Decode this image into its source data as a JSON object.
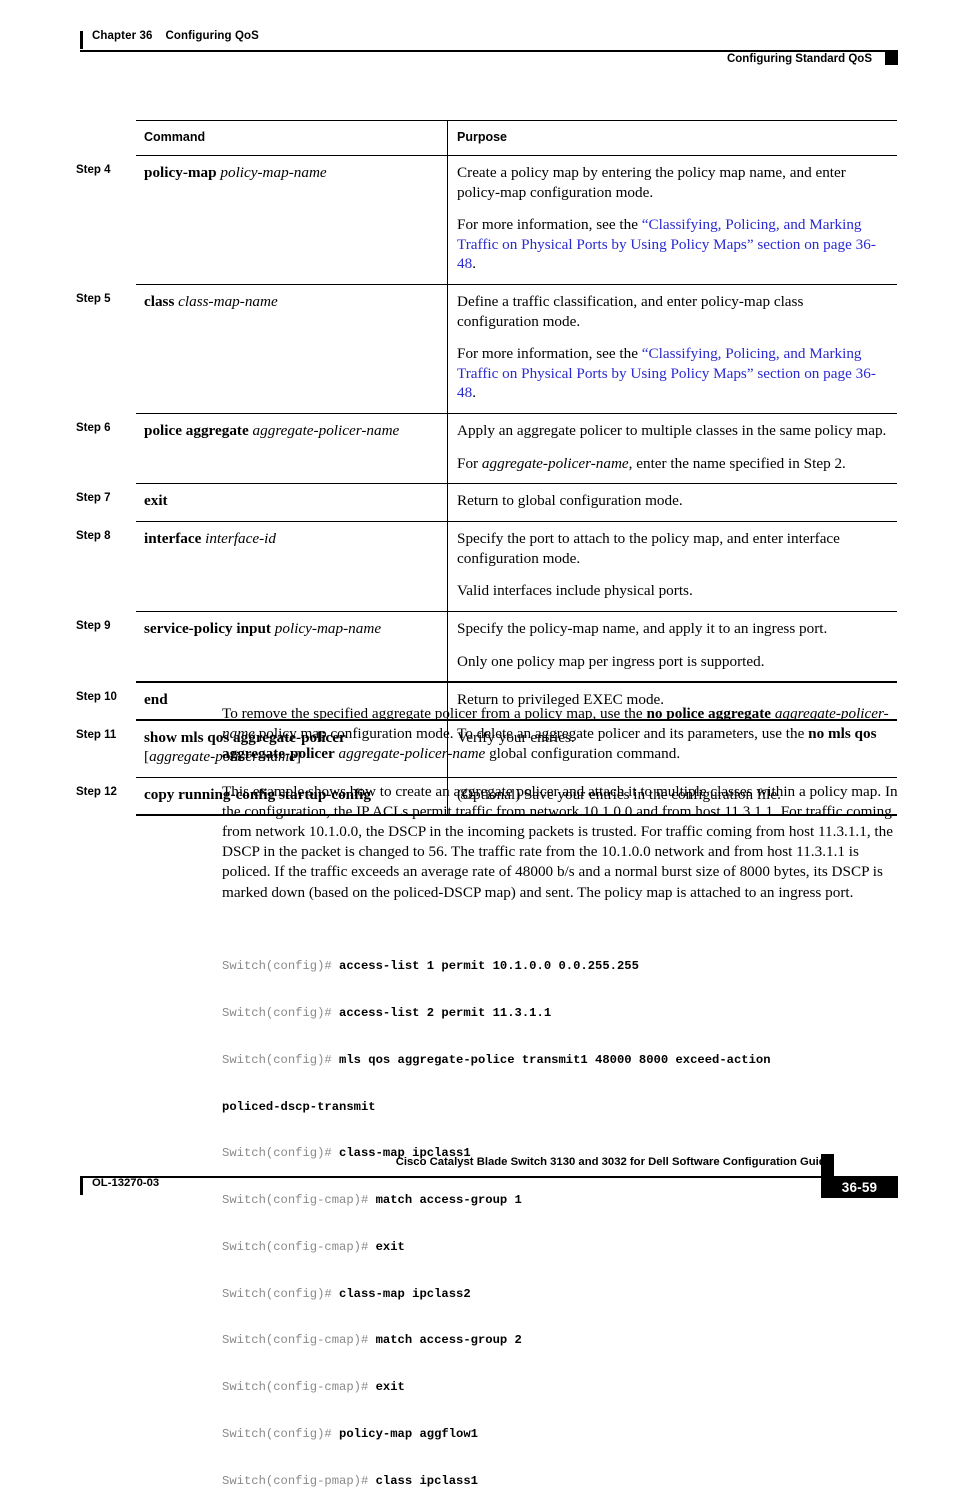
{
  "header": {
    "chapter_number": "Chapter 36",
    "chapter_title": "Configuring QoS",
    "section_title": "Configuring Standard QoS"
  },
  "table": {
    "columns": {
      "command": "Command",
      "purpose": "Purpose"
    },
    "rows": [
      {
        "step": "Step 4",
        "command_bold": "policy-map",
        "command_italic": "policy-map-name",
        "purpose_1": "Create a policy map by entering the policy map name, and enter policy-map configuration mode.",
        "purpose_2_prefix": "For more information, see the ",
        "purpose_2_link": "“Classifying, Policing, and Marking Traffic on Physical Ports by Using Policy Maps” section on page 36-48",
        "purpose_2_suffix": "."
      },
      {
        "step": "Step 5",
        "command_bold": "class",
        "command_italic": "class-map-name",
        "purpose_1": "Define a traffic classification, and enter policy-map class configuration mode.",
        "purpose_2_prefix": "For more information, see the ",
        "purpose_2_link": "“Classifying, Policing, and Marking Traffic on Physical Ports by Using Policy Maps” section on page 36-48",
        "purpose_2_suffix": "."
      },
      {
        "step": "Step 6",
        "command_bold": "police aggregate",
        "command_italic": "aggregate-policer-name",
        "purpose_1": "Apply an aggregate policer to multiple classes in the same policy map.",
        "purpose_2_prefix": "For ",
        "purpose_2_italic": "aggregate-policer-name",
        "purpose_2_suffix": ", enter the name specified in Step 2."
      },
      {
        "step": "Step 7",
        "command_bold": "exit",
        "command_italic": "",
        "purpose_1": "Return to global configuration mode."
      },
      {
        "step": "Step 8",
        "command_bold": "interface",
        "command_italic": "interface-id",
        "purpose_1": "Specify the port to attach to the policy map, and enter interface configuration mode.",
        "purpose_2_plain": "Valid interfaces include physical ports."
      },
      {
        "step": "Step 9",
        "command_bold": "service-policy input",
        "command_italic": "policy-map-name",
        "purpose_1": "Specify the policy-map name, and apply it to an ingress port.",
        "purpose_2_plain": "Only one policy map per ingress port is supported."
      },
      {
        "step": "Step 10",
        "command_bold": "end",
        "command_italic": "",
        "purpose_1": "Return to privileged EXEC mode."
      },
      {
        "step": "Step 11",
        "command_bold": "show mls qos aggregate-policer",
        "command_line2_italic": "aggregate-policer-name",
        "purpose_1": "Verify your entries."
      },
      {
        "step": "Step 12",
        "command_bold": "copy running-config startup-config",
        "command_italic": "",
        "purpose_1": "(Optional) Save your entries in the configuration file."
      }
    ]
  },
  "body": {
    "para1": {
      "t1": "To remove the specified aggregate policer from a policy map, use the ",
      "b1": "no police aggregate",
      "t2": " ",
      "i1": "aggregate-policer-name",
      "t3": " policy map configuration mode. To delete an aggregate policer and its parameters, use the ",
      "b2": "no mls qos aggregate-policer",
      "t4": " ",
      "i2": "aggregate-policer-name",
      "t5": " global configuration command."
    },
    "para2": "This example shows how to create an aggregate policer and attach it to multiple classes within a policy map. In the configuration, the IP ACLs permit traffic from network 10.1.0.0 and from host 11.3.1.1. For traffic coming from network 10.1.0.0, the DSCP in the incoming packets is trusted. For traffic coming from host 11.3.1.1, the DSCP in the packet is changed to 56. The traffic rate from the 10.1.0.0 network and from host 11.3.1.1 is policed. If the traffic exceeds an average rate of 48000 b/s and a normal burst size of 8000 bytes, its DSCP is marked down (based on the policed-DSCP map) and sent. The policy map is attached to an ingress port."
  },
  "code": {
    "lines": [
      {
        "prompt": "Switch(config)# ",
        "command": "access-list 1 permit 10.1.0.0 0.0.255.255"
      },
      {
        "prompt": "Switch(config)# ",
        "command": "access-list 2 permit 11.3.1.1"
      },
      {
        "prompt": "Switch(config)# ",
        "command": "mls qos aggregate-police transmit1 48000 8000 exceed-action"
      },
      {
        "prompt": "",
        "command": "policed-dscp-transmit"
      },
      {
        "prompt": "Switch(config)# ",
        "command": "class-map ipclass1"
      },
      {
        "prompt": "Switch(config-cmap)# ",
        "command": "match access-group 1"
      },
      {
        "prompt": "Switch(config-cmap)# ",
        "command": "exit"
      },
      {
        "prompt": "Switch(config)# ",
        "command": "class-map ipclass2"
      },
      {
        "prompt": "Switch(config-cmap)# ",
        "command": "match access-group 2"
      },
      {
        "prompt": "Switch(config-cmap)# ",
        "command": "exit"
      },
      {
        "prompt": "Switch(config)# ",
        "command": "policy-map aggflow1"
      },
      {
        "prompt": "Switch(config-pmap)# ",
        "command": "class ipclass1"
      }
    ]
  },
  "footer": {
    "guide_title": "Cisco Catalyst Blade Switch 3130 and 3032 for Dell Software Configuration Guide",
    "doc_number": "OL-13270-03",
    "page_number": "36-59"
  },
  "colors": {
    "link": "#2a2ad0",
    "text": "#000000",
    "code_prompt": "#8a8a8a",
    "page_box": "#000000"
  }
}
